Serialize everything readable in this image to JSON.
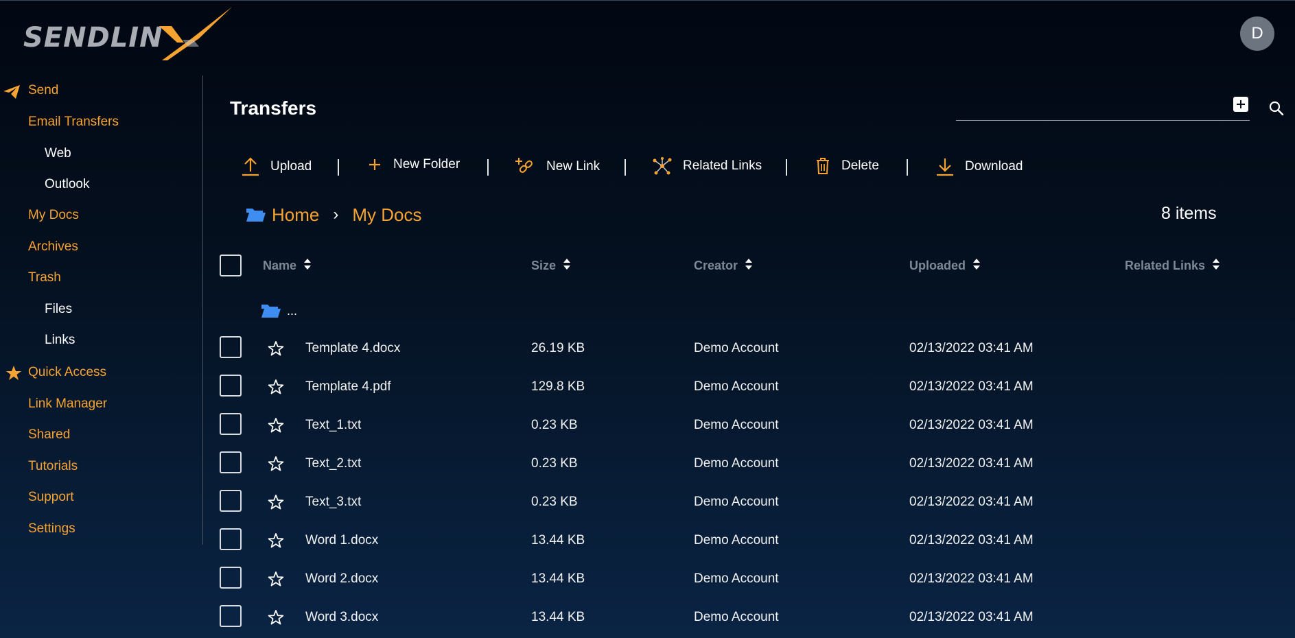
{
  "logo": {
    "text": "SENDLIN"
  },
  "user": {
    "avatar_initial": "D"
  },
  "sidebar": {
    "send": "Send",
    "email_transfers": "Email Transfers",
    "web": "Web",
    "outlook": "Outlook",
    "my_docs": "My Docs",
    "archives": "Archives",
    "trash": "Trash",
    "files": "Files",
    "links": "Links",
    "quick_access": "Quick Access",
    "link_manager": "Link Manager",
    "shared": "Shared",
    "tutorials": "Tutorials",
    "support": "Support",
    "settings": "Settings"
  },
  "header": {
    "title": "Transfers"
  },
  "toolbar": {
    "upload": "Upload",
    "new_folder": "New Folder",
    "new_link": "New Link",
    "related_links": "Related Links",
    "delete": "Delete",
    "download": "Download"
  },
  "breadcrumb": {
    "home": "Home",
    "current": "My Docs"
  },
  "item_count": "8 items",
  "table": {
    "columns": {
      "name": "Name",
      "size": "Size",
      "creator": "Creator",
      "uploaded": "Uploaded",
      "related_links": "Related Links"
    },
    "parent_folder": "...",
    "rows": [
      {
        "name": "Template 4.docx",
        "size": "26.19 KB",
        "creator": "Demo Account",
        "uploaded": "02/13/2022 03:41 AM"
      },
      {
        "name": "Template 4.pdf",
        "size": "129.8 KB",
        "creator": "Demo Account",
        "uploaded": "02/13/2022 03:41 AM"
      },
      {
        "name": "Text_1.txt",
        "size": "0.23 KB",
        "creator": "Demo Account",
        "uploaded": "02/13/2022 03:41 AM"
      },
      {
        "name": "Text_2.txt",
        "size": "0.23 KB",
        "creator": "Demo Account",
        "uploaded": "02/13/2022 03:41 AM"
      },
      {
        "name": "Text_3.txt",
        "size": "0.23 KB",
        "creator": "Demo Account",
        "uploaded": "02/13/2022 03:41 AM"
      },
      {
        "name": "Word 1.docx",
        "size": "13.44 KB",
        "creator": "Demo Account",
        "uploaded": "02/13/2022 03:41 AM"
      },
      {
        "name": "Word 2.docx",
        "size": "13.44 KB",
        "creator": "Demo Account",
        "uploaded": "02/13/2022 03:41 AM"
      },
      {
        "name": "Word 3.docx",
        "size": "13.44 KB",
        "creator": "Demo Account",
        "uploaded": "02/13/2022 03:41 AM"
      }
    ]
  },
  "colors": {
    "accent": "#f6a332",
    "folder": "#3d8ef0",
    "background": "#04101f",
    "muted_header": "#7f8995"
  },
  "icons": {
    "send": "paper-plane-icon",
    "quick_access": "star-icon",
    "add": "plus-box-icon",
    "search": "search-icon",
    "upload": "upload-icon",
    "new_folder": "plus-icon",
    "new_link": "link-plus-icon",
    "related_links": "network-icon",
    "delete": "trash-icon",
    "download": "download-icon",
    "folder": "folder-open-icon",
    "sort": "sort-icon",
    "favorite": "star-outline-icon"
  }
}
